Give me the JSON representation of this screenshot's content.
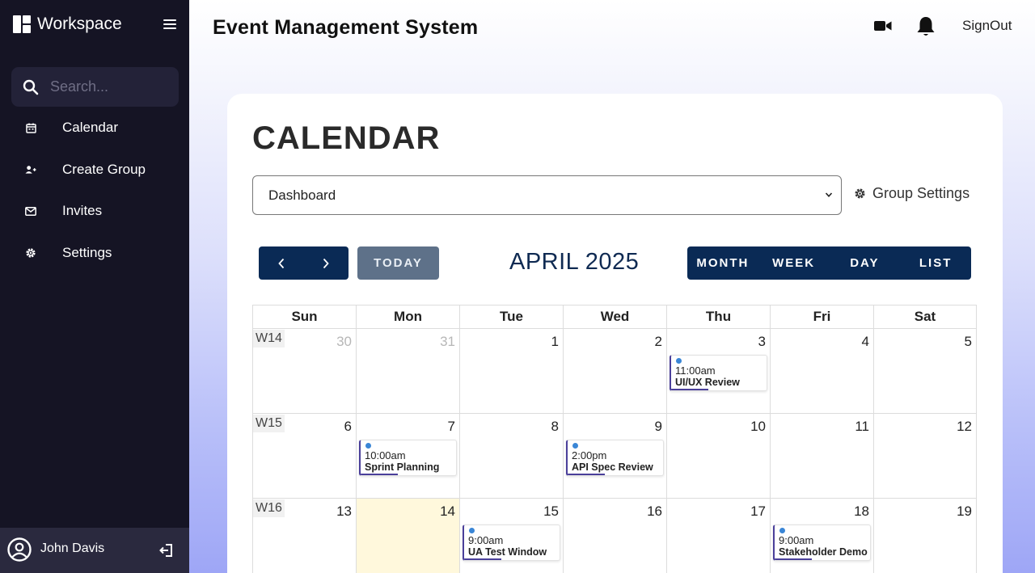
{
  "sidebar": {
    "brand": "Workspace",
    "search_placeholder": "Search...",
    "items": [
      {
        "label": "Calendar",
        "icon": "calendar-icon"
      },
      {
        "label": "Create Group",
        "icon": "add-user-icon"
      },
      {
        "label": "Invites",
        "icon": "mail-icon"
      },
      {
        "label": "Settings",
        "icon": "gear-icon"
      }
    ],
    "user": {
      "name": "John Davis"
    }
  },
  "header": {
    "title": "Event Management System",
    "signout_label": "SignOut"
  },
  "calendar": {
    "heading": "CALENDAR",
    "group_select_value": "Dashboard",
    "group_settings_label": "Group Settings",
    "today_label": "TODAY",
    "month_title": "APRIL 2025",
    "views": [
      "MONTH",
      "WEEK",
      "DAY",
      "LIST"
    ],
    "day_headers": [
      "Sun",
      "Mon",
      "Tue",
      "Wed",
      "Thu",
      "Fri",
      "Sat"
    ],
    "weeks": [
      {
        "label": "W14",
        "days": [
          "30",
          "31",
          "1",
          "2",
          "3",
          "4",
          "5"
        ]
      },
      {
        "label": "W15",
        "days": [
          "6",
          "7",
          "8",
          "9",
          "10",
          "11",
          "12"
        ]
      },
      {
        "label": "W16",
        "days": [
          "13",
          "14",
          "15",
          "16",
          "17",
          "18",
          "19"
        ]
      }
    ],
    "events": [
      {
        "time": "11:00am",
        "title": "UI/UX Review"
      },
      {
        "time": "10:00am",
        "title": "Sprint Planning"
      },
      {
        "time": "2:00pm",
        "title": "API Spec Review"
      },
      {
        "time": "9:00am",
        "title": "UA Test Window"
      },
      {
        "time": "9:00am",
        "title": "Stakeholder Demo"
      }
    ]
  },
  "colors": {
    "sidebar_bg": "#151424",
    "primary_button": "#0a2a55",
    "today_button": "#5e7189",
    "today_cell": "#fff8dc",
    "event_dot": "#3a86d6",
    "event_accent": "#4a3f9a"
  }
}
